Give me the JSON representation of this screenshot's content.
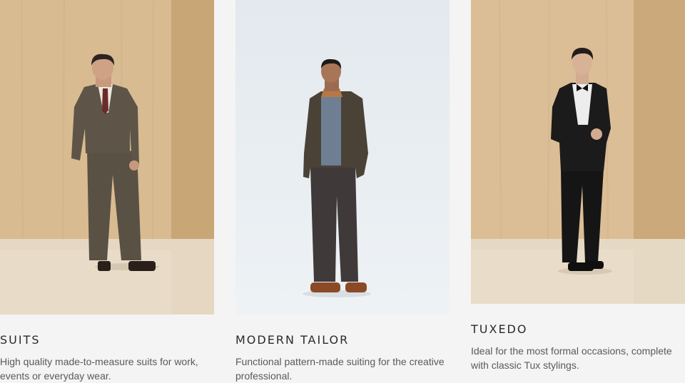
{
  "categories": [
    {
      "title": "SUITS",
      "description": "High quality made-to-measure suits for work, events or everyday wear.",
      "image_alt": "Model wearing a brown check suit"
    },
    {
      "title": "MODERN TAILOR",
      "description": "Functional pattern-made suiting for the creative professional.",
      "image_alt": "Model wearing a dark patterned jacket and trousers"
    },
    {
      "title": "TUXEDO",
      "description": "Ideal for the most formal occasions, complete with classic Tux stylings.",
      "image_alt": "Model wearing a black tuxedo"
    }
  ],
  "colors": {
    "page_bg": "#f4f4f4",
    "wood_wall": "#d7b98f",
    "wood_floor": "#e6d9c3",
    "studio_bg": "#e8edf1",
    "title_text": "#2a2a2a",
    "body_text": "#5a5a5a"
  }
}
